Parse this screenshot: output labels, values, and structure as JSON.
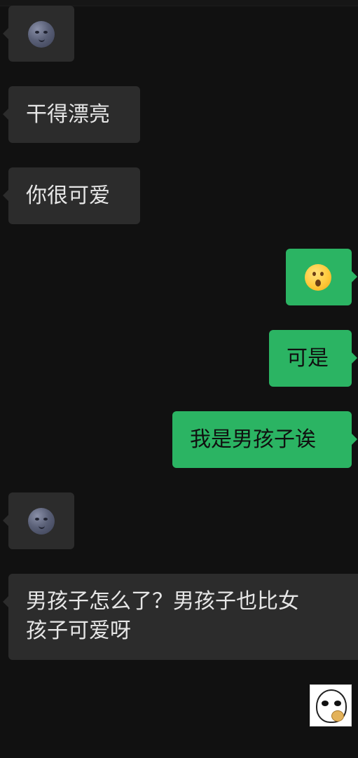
{
  "messages": [
    {
      "side": "left",
      "type": "emoji",
      "emoji": "new-moon-face-icon"
    },
    {
      "side": "left",
      "type": "text",
      "text": "干得漂亮"
    },
    {
      "side": "left",
      "type": "text",
      "text": "你很可爱"
    },
    {
      "side": "right",
      "type": "emoji",
      "emoji": "hushed-face-icon"
    },
    {
      "side": "right",
      "type": "text",
      "text": "可是"
    },
    {
      "side": "right",
      "type": "text",
      "text": "我是男孩子诶"
    },
    {
      "side": "left",
      "type": "emoji",
      "emoji": "new-moon-face-icon"
    },
    {
      "side": "left",
      "type": "text",
      "lines": [
        "男孩子怎么了？男孩子也比女",
        "孩子可爱呀"
      ]
    },
    {
      "side": "right",
      "type": "sticker",
      "sticker": "cartoon-face-eating-sticker"
    }
  ],
  "colors": {
    "background": "#111111",
    "incoming_bubble": "#2c2c2c",
    "outgoing_bubble": "#2bb463",
    "incoming_text": "#e6e6e6",
    "outgoing_text": "#101010"
  }
}
